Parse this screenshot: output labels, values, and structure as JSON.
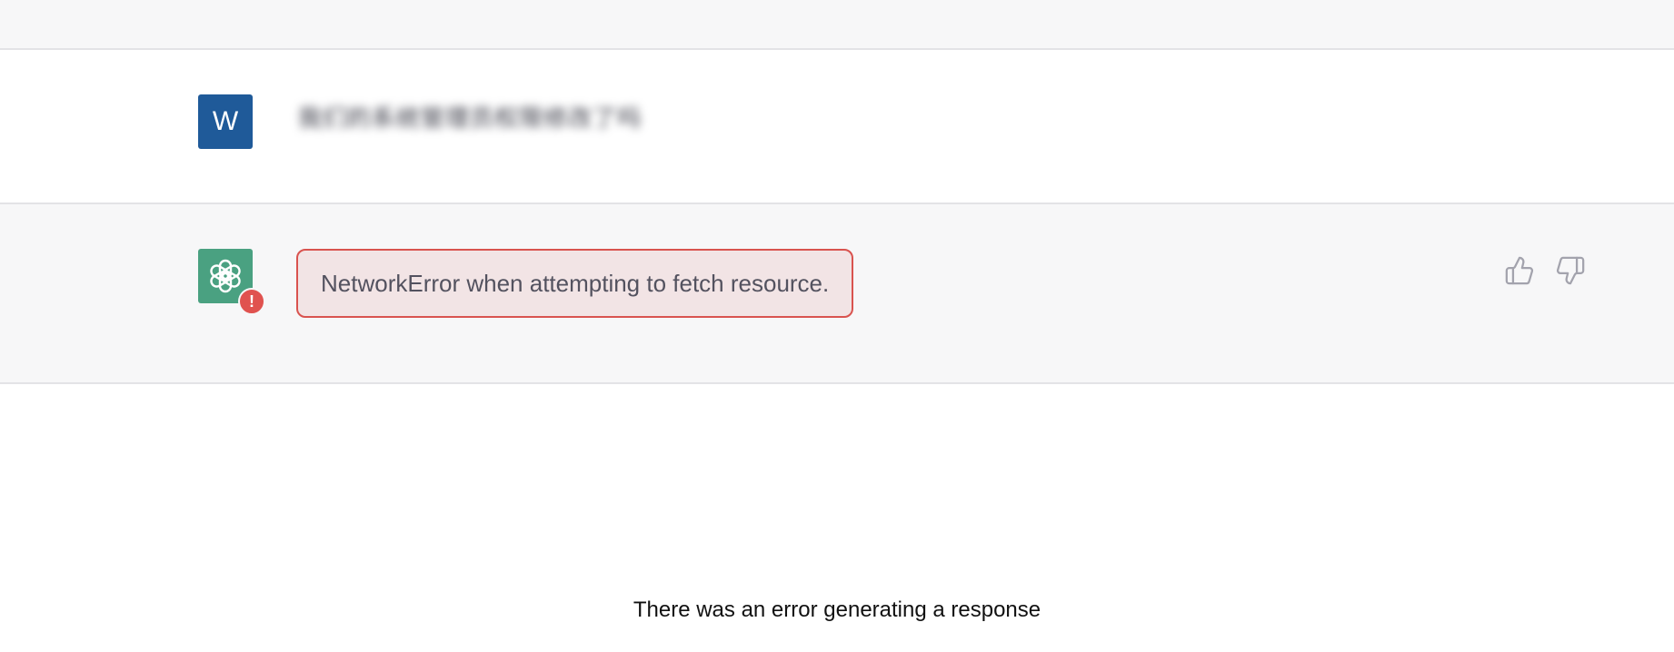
{
  "user": {
    "avatar_letter": "W",
    "message": "我们的系统管理员权限修改了吗"
  },
  "assistant": {
    "avatar_icon": "openai-logo-icon",
    "error_badge_glyph": "!",
    "error_message": "NetworkError when attempting to fetch resource."
  },
  "feedback": {
    "thumbs_up_icon": "thumbs-up-icon",
    "thumbs_down_icon": "thumbs-down-icon"
  },
  "footer": {
    "error_text": "There was an error generating a response"
  },
  "colors": {
    "user_avatar_bg": "#1f5a99",
    "assistant_avatar_bg": "#4aa181",
    "error_border": "#d9534f",
    "error_bg": "#f2e4e5",
    "badge_bg": "#e0524f"
  }
}
